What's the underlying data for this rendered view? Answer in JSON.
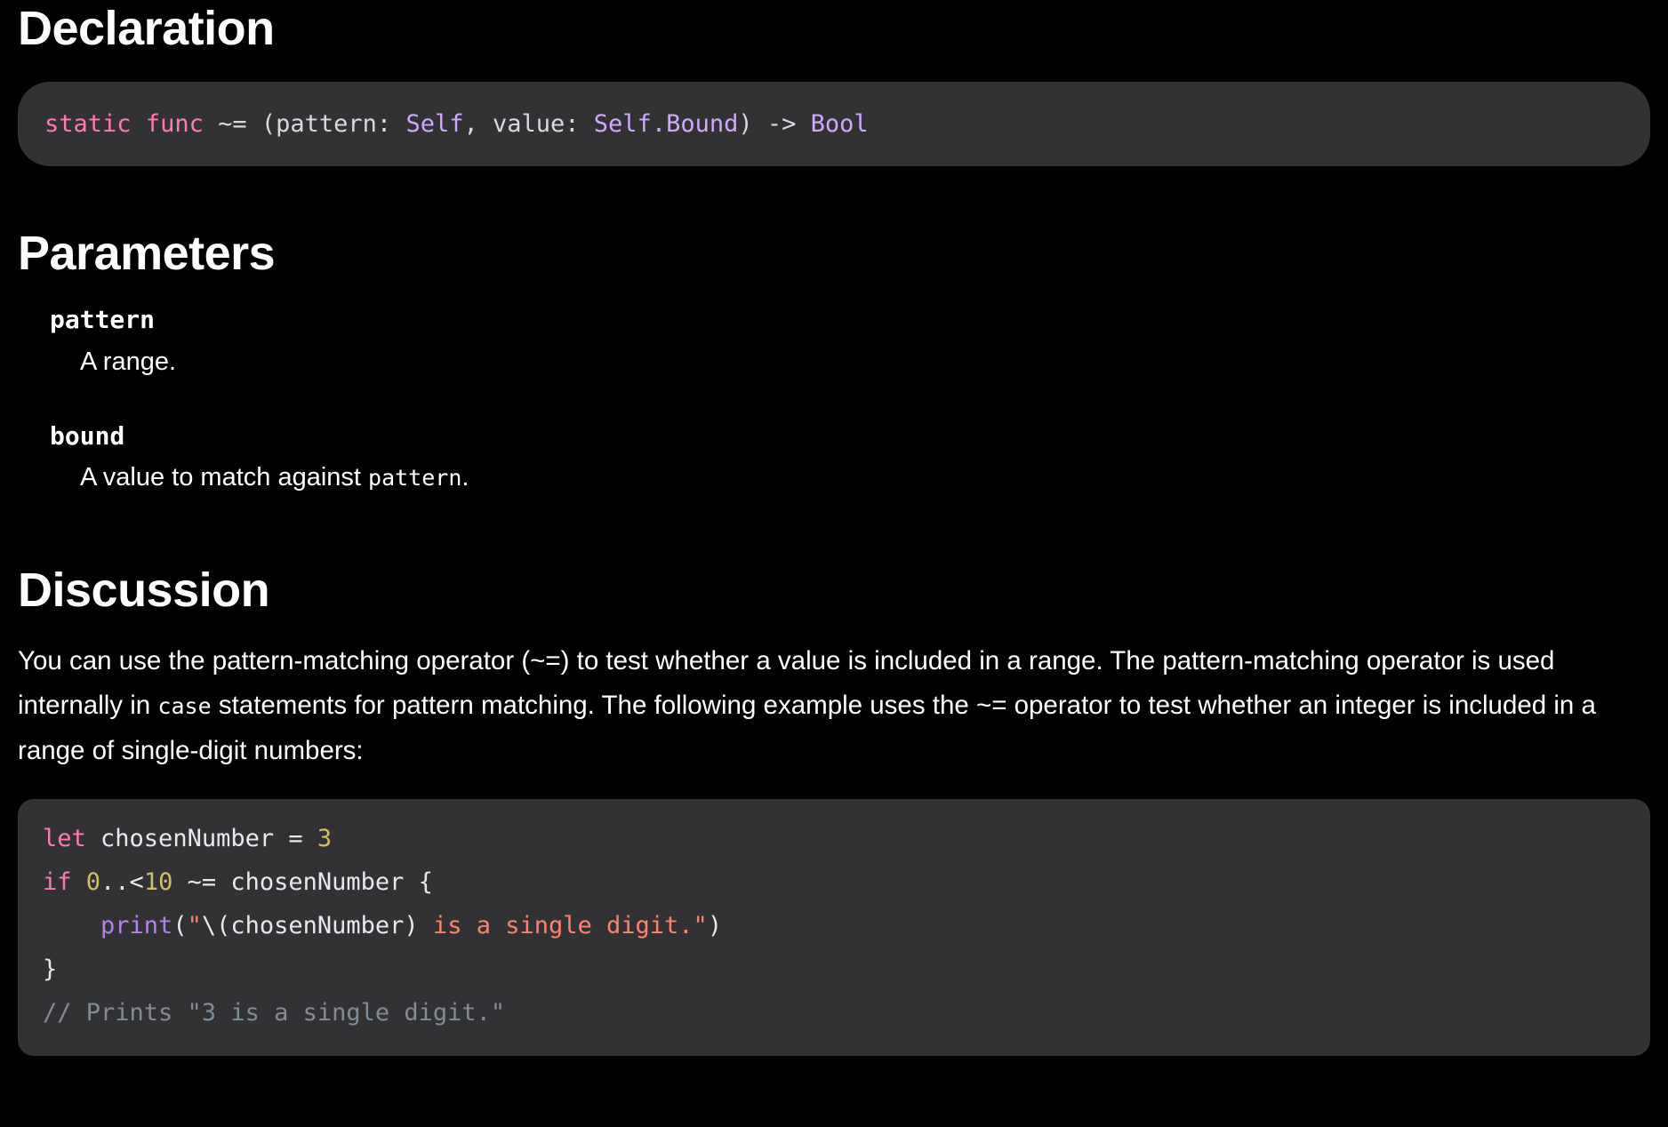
{
  "sections": {
    "declaration": {
      "title": "Declaration",
      "code_plain": "static func ~= (pattern: Self, value: Self.Bound) -> Bool",
      "tokens": {
        "static": "static",
        "func": "func",
        "operator": "~=",
        "open_paren": " (",
        "pattern_label": "pattern: ",
        "self_type": "Self",
        "comma": ", ",
        "value_label": "value: ",
        "bound_type": "Self.Bound",
        "close_paren": ") ",
        "arrow": "-> ",
        "return_type": "Bool"
      }
    },
    "parameters": {
      "title": "Parameters",
      "items": [
        {
          "name": "pattern",
          "description": "A range.",
          "description_code": "",
          "description_tail": ""
        },
        {
          "name": "bound",
          "description": "A value to match against ",
          "description_code": "pattern",
          "description_tail": "."
        }
      ]
    },
    "discussion": {
      "title": "Discussion",
      "paragraph_part1": "You can use the pattern-matching operator (~=) to test whether a value is included in a range. The pattern-matching operator is used internally in ",
      "paragraph_code": "case",
      "paragraph_part2": " statements for pattern matching. The following example uses the ~= operator to test whether an integer is included in a range of single-digit numbers:",
      "example_code": {
        "line1": {
          "keyword": "let",
          "identifier": " chosenNumber = ",
          "number": "3"
        },
        "line2": {
          "keyword": "if",
          "range_start": " 0",
          "range_dots": "..<",
          "range_end": "10",
          "rest": " ~= chosenNumber {"
        },
        "line3": {
          "indent": "    ",
          "fn": "print",
          "open": "(",
          "quote_open": "\"",
          "interp": "\\(chosenNumber)",
          "string": " is a single digit.",
          "quote_close": "\"",
          "close": ")"
        },
        "line4": {
          "brace": "}"
        },
        "line5": {
          "comment": "// Prints \"3 is a single digit.\""
        }
      }
    }
  },
  "colors": {
    "background": "#000000",
    "code_background": "#323234",
    "text": "#ffffff",
    "keyword": "#ff7ab2",
    "type": "#d0a8ff",
    "number": "#d0bf69",
    "string": "#ff8170",
    "function": "#b281eb",
    "comment": "#7f8c98",
    "code_text": "#e8e8ed"
  }
}
